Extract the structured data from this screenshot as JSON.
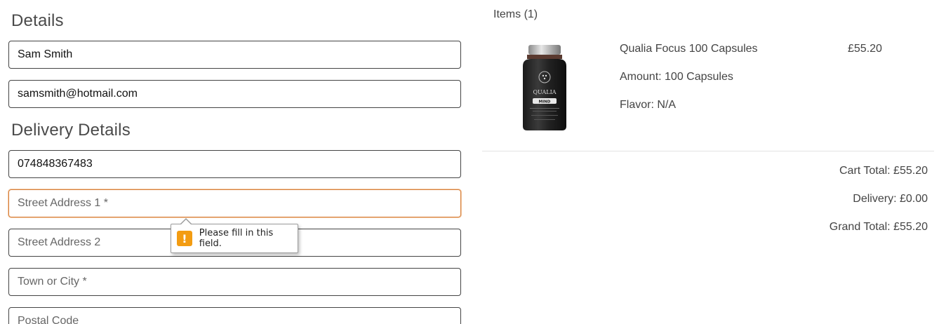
{
  "form": {
    "details_title": "Details",
    "delivery_title": "Delivery Details",
    "full_name_value": "Sam Smith",
    "email_value": "samsmith@hotmail.com",
    "phone_value": "074848367483",
    "street1_placeholder": "Street Address 1 *",
    "street2_placeholder": "Street Address 2",
    "town_placeholder": "Town or City *",
    "postal_placeholder": "Postal Code"
  },
  "validation_tooltip": {
    "icon": "warning-icon",
    "icon_glyph": "!",
    "message": "Please fill in this field.",
    "icon_color": "#f39c12"
  },
  "summary": {
    "items_label": "Items (1)",
    "product": {
      "name": "Qualia Focus 100 Capsules",
      "amount": "Amount: 100 Capsules",
      "flavor": "Flavor: N/A",
      "price": "£55.20",
      "image_brand_text": "QUALIA",
      "image_sub_text": "MIND"
    },
    "cart_total": "Cart Total: £55.20",
    "delivery": "Delivery: £0.00",
    "grand_total": "Grand Total: £55.20"
  },
  "colors": {
    "invalid_border": "#d7813d",
    "text": "#444444"
  }
}
